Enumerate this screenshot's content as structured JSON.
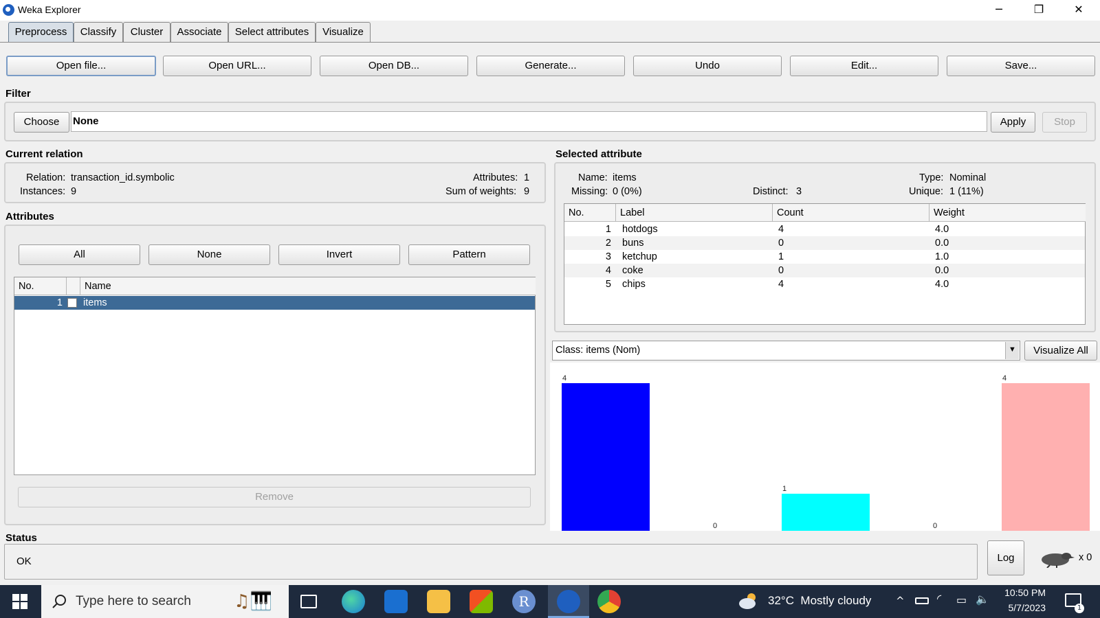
{
  "window": {
    "title": "Weka Explorer",
    "controls": [
      "─",
      "❐",
      "✕"
    ]
  },
  "tabs": [
    "Preprocess",
    "Classify",
    "Cluster",
    "Associate",
    "Select attributes",
    "Visualize"
  ],
  "toolbar": [
    "Open file...",
    "Open URL...",
    "Open DB...",
    "Generate...",
    "Undo",
    "Edit...",
    "Save..."
  ],
  "filter": {
    "label": "Filter",
    "choose": "Choose",
    "value": "None",
    "apply": "Apply",
    "stop": "Stop"
  },
  "current_relation": {
    "label": "Current relation",
    "relation_label": "Relation:",
    "relation": "transaction_id.symbolic",
    "instances_label": "Instances:",
    "instances": "9",
    "attributes_label": "Attributes:",
    "attributes": "1",
    "sum_weights_label": "Sum of weights:",
    "sum_weights": "9"
  },
  "attributes": {
    "label": "Attributes",
    "buttons": [
      "All",
      "None",
      "Invert",
      "Pattern"
    ],
    "headers": [
      "No.",
      "",
      "Name"
    ],
    "rows": [
      {
        "no": "1",
        "name": "items"
      }
    ],
    "remove": "Remove"
  },
  "selected_attribute": {
    "label": "Selected attribute",
    "name_label": "Name:",
    "name": "items",
    "type_label": "Type:",
    "type": "Nominal",
    "missing_label": "Missing:",
    "missing": "0 (0%)",
    "distinct_label": "Distinct:",
    "distinct": "3",
    "unique_label": "Unique:",
    "unique": "1 (11%)",
    "headers": [
      "No.",
      "Label",
      "Count",
      "Weight"
    ],
    "rows": [
      {
        "no": "1",
        "label": "hotdogs",
        "count": "4",
        "weight": "4.0"
      },
      {
        "no": "2",
        "label": "buns",
        "count": "0",
        "weight": "0.0"
      },
      {
        "no": "3",
        "label": "ketchup",
        "count": "1",
        "weight": "1.0"
      },
      {
        "no": "4",
        "label": "coke",
        "count": "0",
        "weight": "0.0"
      },
      {
        "no": "5",
        "label": "chips",
        "count": "4",
        "weight": "4.0"
      }
    ]
  },
  "class_select": {
    "value": "Class: items (Nom)",
    "visualize_all": "Visualize All"
  },
  "chart_data": {
    "type": "bar",
    "categories": [
      "hotdogs",
      "buns",
      "ketchup",
      "coke",
      "chips"
    ],
    "values": [
      4,
      0,
      1,
      0,
      4
    ],
    "colors": [
      "#0000ff",
      "#ff0000",
      "#00ffff",
      "#000000",
      "#ffb0b0"
    ],
    "ylim": [
      0,
      4
    ]
  },
  "status": {
    "label": "Status",
    "text": "OK",
    "log": "Log",
    "count": "x 0"
  },
  "taskbar": {
    "search_placeholder": "Type here to search",
    "weather": "32°C  Mostly cloudy",
    "time": "10:50 PM",
    "date": "5/7/2023",
    "notif": "1"
  },
  "colors": {
    "selection": "#3d6a96",
    "taskbar": "#1e2a3d"
  }
}
